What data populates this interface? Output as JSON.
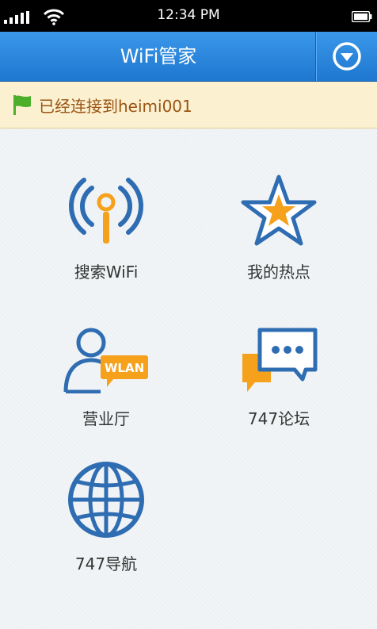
{
  "status_bar": {
    "time": "12:34 PM"
  },
  "header": {
    "title": "WiFi管家"
  },
  "notice": {
    "text": "已经连接到heimi001"
  },
  "tiles": [
    {
      "label": "搜索WiFi",
      "icon": "wifi-antenna-icon"
    },
    {
      "label": "我的热点",
      "icon": "star-icon"
    },
    {
      "label": "营业厅",
      "icon": "wlan-person-icon"
    },
    {
      "label": "747论坛",
      "icon": "chat-bubbles-icon"
    },
    {
      "label": "747导航",
      "icon": "globe-icon"
    }
  ],
  "colors": {
    "header": "#2a88dd",
    "icon_blue": "#2f6db3",
    "icon_orange": "#f5a11c",
    "notice_bg": "#fbf0cf",
    "notice_text": "#9a5314",
    "flag_green": "#4caf2a"
  },
  "icons": {
    "menu": "chevron-down-circle-icon",
    "flag": "flag-icon",
    "signal": "signal-icon",
    "wifi": "wifi-icon",
    "battery": "battery-icon"
  }
}
